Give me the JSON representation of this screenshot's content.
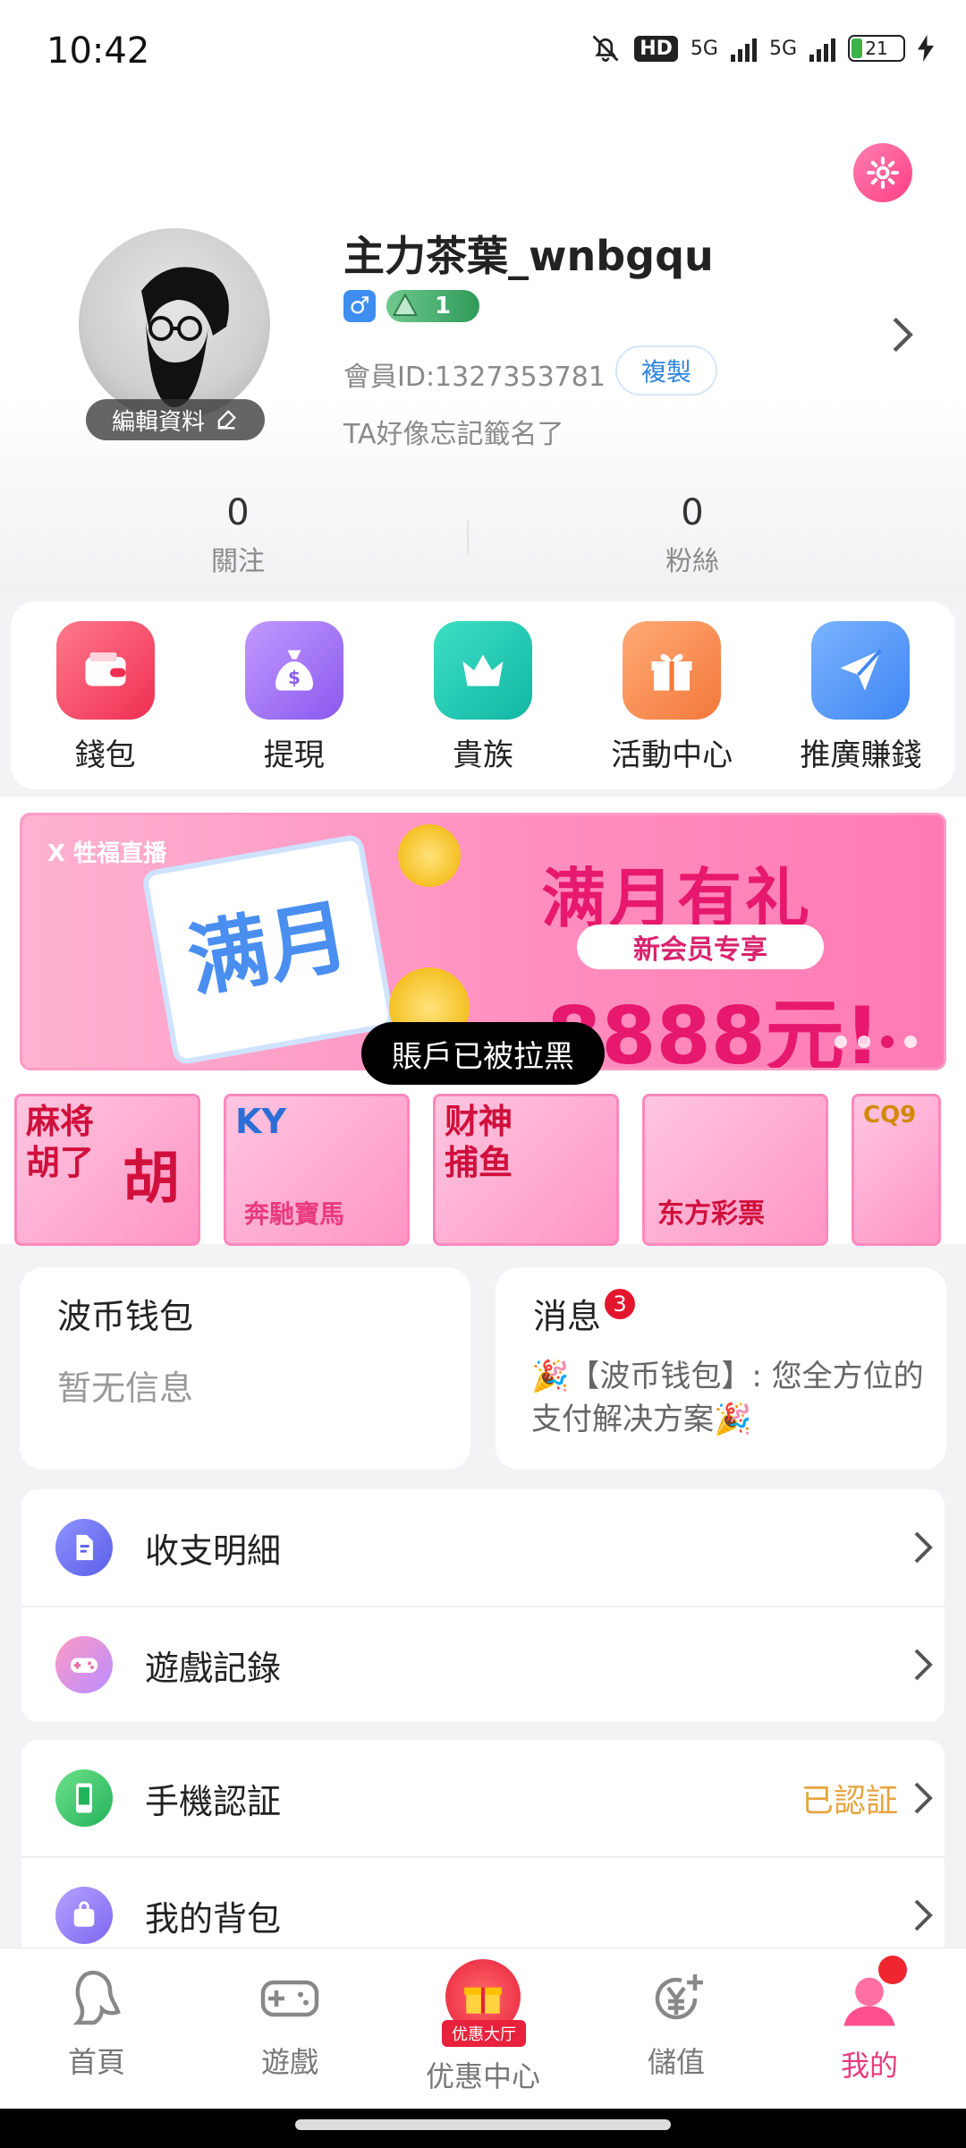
{
  "status_bar": {
    "time": "10:42",
    "hd": "HD",
    "net1": "5G",
    "net2": "5G",
    "battery": "21"
  },
  "profile": {
    "nickname": "主力茶葉_wnbgqu",
    "gender_symbol": "♂",
    "level": "1",
    "member_id": "會員ID:1327353781",
    "copy_label": "複製",
    "signature": "TA好像忘記籤名了",
    "edit_label": "編輯資料",
    "following_count": "0",
    "following_label": "關注",
    "fans_count": "0",
    "fans_label": "粉絲"
  },
  "quick_menu": [
    {
      "label": "錢包",
      "icon": "wallet-icon",
      "color": "#f2435c"
    },
    {
      "label": "提現",
      "icon": "money-bag-icon",
      "color": "#9b6bf2"
    },
    {
      "label": "貴族",
      "icon": "crown-icon",
      "color": "#1fc8b2"
    },
    {
      "label": "活動中心",
      "icon": "gift-icon",
      "color": "#f78b4a"
    },
    {
      "label": "推廣賺錢",
      "icon": "paper-plane-icon",
      "color": "#4a8ff5"
    }
  ],
  "banner": {
    "brand": "X 牲福直播",
    "calendar_text": "满月",
    "headline": "满月有礼",
    "subtitle": "新会员专享",
    "amount": "8888元!",
    "active_dot": 3
  },
  "toast": "賬戶已被拉黑",
  "games": [
    {
      "title": "麻将\n胡了",
      "sub": "胡"
    },
    {
      "title": "KY",
      "sub": "奔馳寶馬"
    },
    {
      "title": "财神\n捕鱼",
      "sub": ""
    },
    {
      "title": "",
      "sub": "东方彩票"
    },
    {
      "title": "CQ9",
      "sub": ""
    }
  ],
  "wallet_card": {
    "title": "波币钱包",
    "body": "暂无信息"
  },
  "message_card": {
    "title": "消息",
    "badge": "3",
    "body": "🎉【波币钱包】: 您全方位的支付解决方案🎉"
  },
  "list1": [
    {
      "label": "收支明細",
      "icon": "document-icon",
      "color": "#6b6ef2"
    },
    {
      "label": "遊戲記錄",
      "icon": "gamepad-icon",
      "color": "#f27bb0"
    }
  ],
  "list2": [
    {
      "label": "手機認証",
      "icon": "phone-icon",
      "color": "#3cc26e",
      "value": "已認証"
    },
    {
      "label": "我的背包",
      "icon": "backpack-icon",
      "color": "#8f7cf2",
      "value": ""
    }
  ],
  "bottom_nav": [
    {
      "label": "首頁",
      "icon": "home-lady-icon"
    },
    {
      "label": "遊戲",
      "icon": "gamepad-icon"
    },
    {
      "label": "优惠中心",
      "icon": "gift-box-icon",
      "tag": "优惠大厅"
    },
    {
      "label": "儲值",
      "icon": "yen-plus-icon"
    },
    {
      "label": "我的",
      "icon": "user-icon"
    }
  ]
}
